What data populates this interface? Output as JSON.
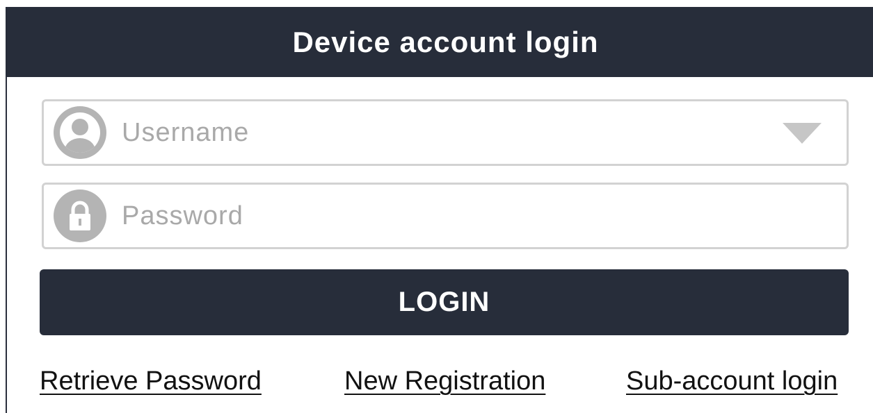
{
  "header": {
    "title": "Device account login"
  },
  "username": {
    "placeholder": "Username",
    "icon": "user-icon"
  },
  "password": {
    "placeholder": "Password",
    "icon": "lock-icon"
  },
  "login_button": {
    "label": "LOGIN"
  },
  "links": {
    "retrieve_password": "Retrieve Password",
    "new_registration": "New Registration",
    "sub_account_login": "Sub-account login"
  },
  "colors": {
    "header_bg": "#272d3a",
    "button_bg": "#272d3a",
    "field_border": "#d2d2d2",
    "icon_gray": "#b4b4b4",
    "placeholder": "#a9a9a9"
  }
}
